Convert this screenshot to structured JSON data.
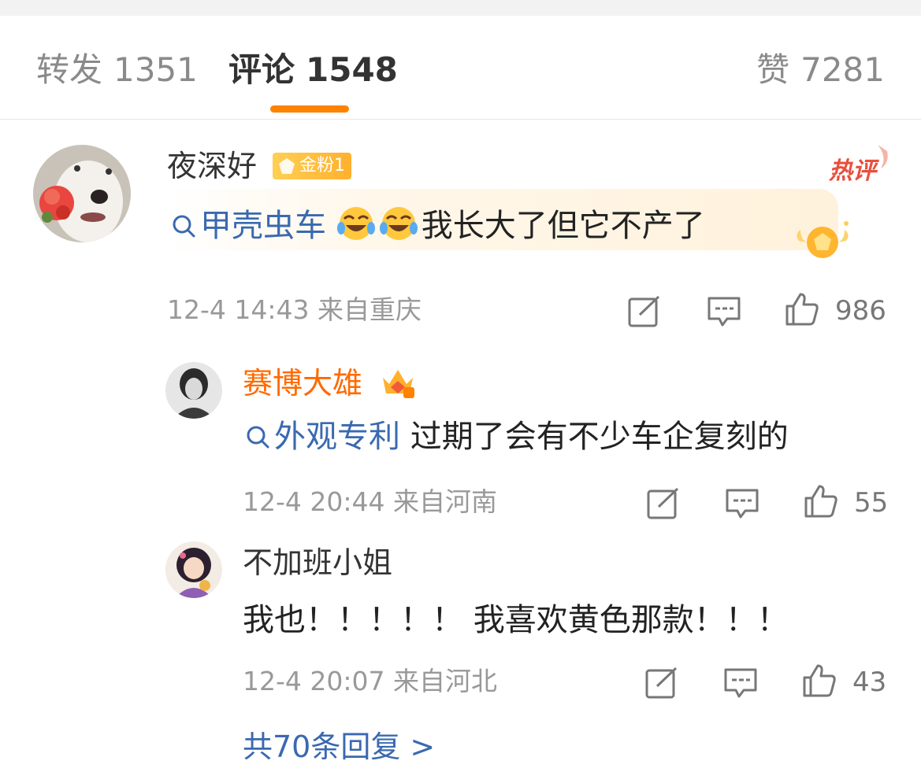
{
  "tabs": {
    "repost": {
      "label": "转发",
      "count": "1351"
    },
    "comments": {
      "label": "评论",
      "count": "1548"
    },
    "likes": {
      "label": "赞",
      "count": "7281"
    }
  },
  "accent": "#ff8200",
  "comments": [
    {
      "username": "夜深好",
      "fan_badge": "金粉1",
      "hot_tag": "热评",
      "topic": "甲壳虫车",
      "emojis": [
        "laugh-cry-emoji",
        "laugh-cry-emoji"
      ],
      "text": "我长大了但它不产了",
      "time": "12-4 14:43",
      "location": "来自重庆",
      "likes": "986"
    }
  ],
  "replies": [
    {
      "username": "赛博大雄",
      "topic": "外观专利",
      "text": "过期了会有不少车企复刻的",
      "time": "12-4 20:44",
      "location": "来自河南",
      "likes": "55"
    },
    {
      "username": "不加班小姐",
      "text": "我也！！！！！ 我喜欢黄色那款！！！",
      "time": "12-4 20:07",
      "location": "来自河北",
      "likes": "43"
    }
  ],
  "more_replies": "共70条回复 >"
}
